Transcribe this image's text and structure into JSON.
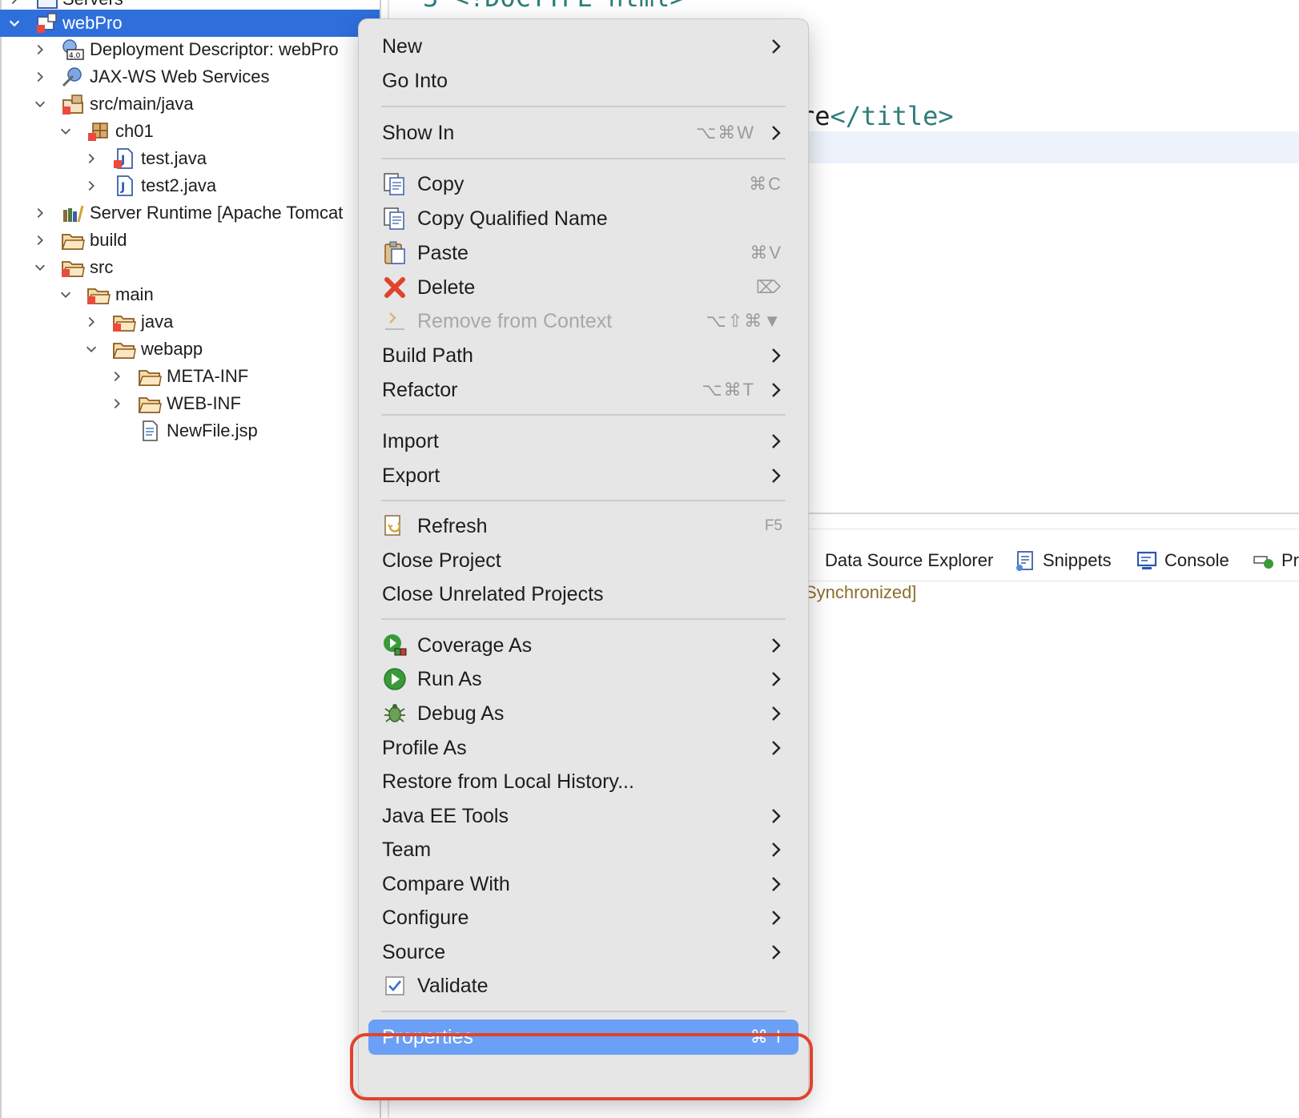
{
  "explorer": {
    "items": [
      {
        "label": "Servers",
        "icon": "servers-folder-icon"
      },
      {
        "label": "webPro",
        "icon": "web-project-icon",
        "expanded": true,
        "selected": true
      },
      {
        "label": "Deployment Descriptor: webPro",
        "icon": "deployment-descriptor-icon"
      },
      {
        "label": "JAX-WS Web Services",
        "icon": "web-services-icon"
      },
      {
        "label": "src/main/java",
        "icon": "source-folder-icon",
        "expanded": true
      },
      {
        "label": "ch01",
        "icon": "package-icon",
        "expanded": true
      },
      {
        "label": "test.java",
        "icon": "java-file-icon"
      },
      {
        "label": "test2.java",
        "icon": "java-file-icon"
      },
      {
        "label": "Server Runtime [Apache Tomcat",
        "icon": "server-runtime-icon"
      },
      {
        "label": "build",
        "icon": "folder-icon"
      },
      {
        "label": "src",
        "icon": "folder-icon",
        "expanded": true
      },
      {
        "label": "main",
        "icon": "folder-icon",
        "expanded": true
      },
      {
        "label": "java",
        "icon": "folder-icon"
      },
      {
        "label": "webapp",
        "icon": "folder-icon",
        "expanded": true
      },
      {
        "label": "META-INF",
        "icon": "folder-icon"
      },
      {
        "label": "WEB-INF",
        "icon": "folder-icon"
      },
      {
        "label": "NewFile.jsp",
        "icon": "jsp-file-icon"
      }
    ]
  },
  "editor": {
    "line_top": "3  <!DOCTYPE html>",
    "line_title_prefix": "re",
    "line_title_tag": "</title>"
  },
  "views": {
    "tabs": [
      {
        "label": "Data Source Explorer",
        "icon": "data-source-explorer-icon"
      },
      {
        "label": "Snippets",
        "icon": "snippets-icon"
      },
      {
        "label": "Console",
        "icon": "console-icon"
      },
      {
        "label": "Pr",
        "icon": "progress-icon"
      }
    ],
    "status_text": "Synchronized]"
  },
  "menu": {
    "new": "New",
    "go_into": "Go Into",
    "show_in": "Show In",
    "show_in_shortcut": "⌥⌘W",
    "copy": "Copy",
    "copy_shortcut": "⌘C",
    "copy_qualified": "Copy Qualified Name",
    "paste": "Paste",
    "paste_shortcut": "⌘V",
    "delete": "Delete",
    "delete_shortcut": "⌦",
    "remove_context": "Remove from Context",
    "remove_context_shortcut": "⌥⇧⌘▼",
    "build_path": "Build Path",
    "refactor": "Refactor",
    "refactor_shortcut": "⌥⌘T",
    "import": "Import",
    "export": "Export",
    "refresh": "Refresh",
    "refresh_shortcut": "F5",
    "close_project": "Close Project",
    "close_unrelated": "Close Unrelated Projects",
    "coverage_as": "Coverage As",
    "run_as": "Run As",
    "debug_as": "Debug As",
    "profile_as": "Profile As",
    "restore_history": "Restore from Local History...",
    "java_ee_tools": "Java EE Tools",
    "team": "Team",
    "compare_with": "Compare With",
    "configure": "Configure",
    "source": "Source",
    "validate": "Validate",
    "properties": "Properties",
    "properties_shortcut": "⌘ I"
  },
  "colors": {
    "selection": "#2f6fdc",
    "menu_selected": "#6aa0f6",
    "annotation": "#e0432c",
    "code_tag": "#2e7d7a"
  }
}
